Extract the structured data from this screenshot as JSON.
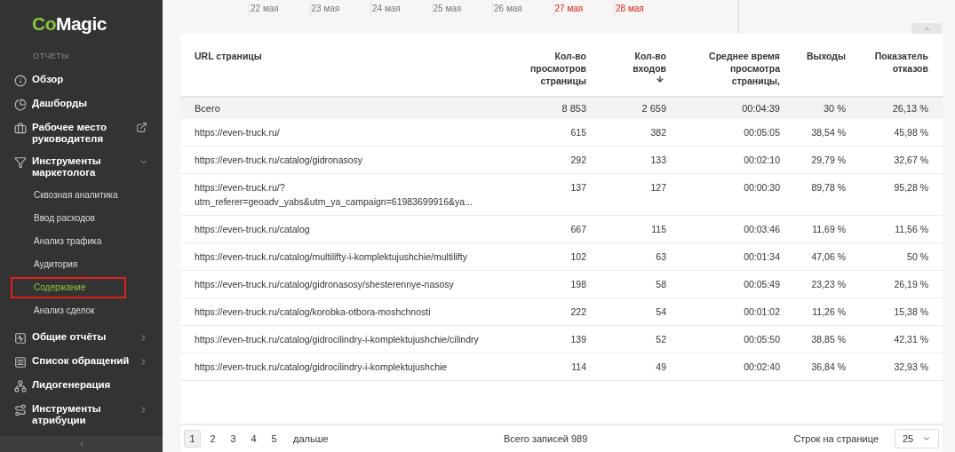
{
  "sidebar": {
    "logo": {
      "part_1": "Co",
      "part_2": "Magic"
    },
    "section": "ОТЧЕТЫ",
    "items": [
      {
        "label": "Обзор"
      },
      {
        "label": "Дашборды"
      },
      {
        "label": "Рабочее место руководителя",
        "external": true
      },
      {
        "label": "Инструменты маркетолога",
        "expanded": true,
        "children": [
          {
            "label": "Сквозная аналитика",
            "selected": false,
            "highlighted": false
          },
          {
            "label": "Ввод расходов",
            "selected": false,
            "highlighted": false
          },
          {
            "label": "Анализ трафика",
            "selected": false,
            "highlighted": false
          },
          {
            "label": "Аудитория",
            "selected": false,
            "highlighted": false
          },
          {
            "label": "Содержание",
            "selected": true,
            "highlighted": true
          },
          {
            "label": "Анализ сделок",
            "selected": false,
            "highlighted": false
          }
        ]
      },
      {
        "label": "Общие отчёты",
        "expanded": false
      },
      {
        "label": "Список обращений",
        "expanded": false
      },
      {
        "label": "Лидогенерация"
      },
      {
        "label": "Инструменты атрибуции",
        "expanded": false
      }
    ]
  },
  "dates": [
    {
      "label": "22 мая",
      "weekend": false
    },
    {
      "label": "23 мая",
      "weekend": false
    },
    {
      "label": "24 мая",
      "weekend": false
    },
    {
      "label": "25 мая",
      "weekend": false
    },
    {
      "label": "26 мая",
      "weekend": false
    },
    {
      "label": "27 мая",
      "weekend": true
    },
    {
      "label": "28 мая",
      "weekend": true
    }
  ],
  "table": {
    "columns": [
      {
        "label": "URL страницы",
        "sorted": false
      },
      {
        "label": "Кол-во просмотров страницы",
        "sorted": false
      },
      {
        "label": "Кол-во входов",
        "sorted": true
      },
      {
        "label": "Среднее время просмотра страницы,",
        "sorted": false
      },
      {
        "label": "Выходы",
        "sorted": false
      },
      {
        "label": "Показатель отказов",
        "sorted": false
      }
    ],
    "total": [
      "Всего",
      "8 853",
      "2 659",
      "00:04:39",
      "30 %",
      "26,13 %"
    ],
    "rows": [
      [
        "https://even-truck.ru/",
        "615",
        "382",
        "00:05:05",
        "38,54 %",
        "45,98 %"
      ],
      [
        "https://even-truck.ru/catalog/gidronasosy",
        "292",
        "133",
        "00:02:10",
        "29,79 %",
        "32,67 %"
      ],
      [
        "https://even-truck.ru/?utm_referer=geoadv_yabs&utm_ya_campaign=61983699916&ya...",
        "137",
        "127",
        "00:00:30",
        "89,78 %",
        "95,28 %"
      ],
      [
        "https://even-truck.ru/catalog",
        "667",
        "115",
        "00:03:46",
        "11,69 %",
        "11,56 %"
      ],
      [
        "https://even-truck.ru/catalog/multilifty-i-komplektujushchie/multilifty",
        "102",
        "63",
        "00:01:34",
        "47,06 %",
        "50 %"
      ],
      [
        "https://even-truck.ru/catalog/gidronasosy/shesterennye-nasosy",
        "198",
        "58",
        "00:05:49",
        "23,23 %",
        "26,19 %"
      ],
      [
        "https://even-truck.ru/catalog/korobka-otbora-moshchnosti",
        "222",
        "54",
        "00:01:02",
        "11,26 %",
        "15,38 %"
      ],
      [
        "https://even-truck.ru/catalog/gidrocilindry-i-komplektujushchie/cilindry",
        "139",
        "52",
        "00:05:50",
        "38,85 %",
        "42,31 %"
      ],
      [
        "https://even-truck.ru/catalog/gidrocilindry-i-komplektujushchie",
        "114",
        "49",
        "00:02:40",
        "36,84 %",
        "32,93 %"
      ]
    ]
  },
  "pagination": {
    "pages": [
      {
        "label": "1",
        "selected": true
      },
      {
        "label": "2",
        "selected": false
      },
      {
        "label": "3",
        "selected": false
      },
      {
        "label": "4",
        "selected": false
      },
      {
        "label": "5",
        "selected": false
      }
    ],
    "next": "дальше",
    "total": "Всего записей 989",
    "rows_label": "Строк на странице",
    "rows_value": "25"
  }
}
